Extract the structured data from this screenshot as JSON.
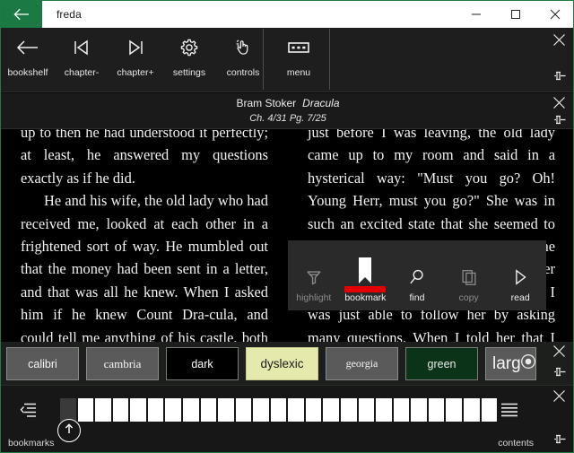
{
  "window": {
    "title": "freda",
    "back_icon": "back-arrow-icon",
    "minimize_label": "─",
    "maximize_label": "☐",
    "close_label": "✕",
    "accent_color": "#1b7a43"
  },
  "toolbar": {
    "items": [
      {
        "label": "bookshelf",
        "icon": "back-arrow-icon"
      },
      {
        "label": "chapter-",
        "icon": "previous-chapter-icon"
      },
      {
        "label": "chapter+",
        "icon": "next-chapter-icon"
      },
      {
        "label": "settings",
        "icon": "gear-icon"
      },
      {
        "label": "controls",
        "icon": "hand-tap-icon"
      },
      {
        "label": "menu",
        "icon": "menu-box-icon"
      }
    ],
    "close_icon": "close-icon",
    "pin_icon": "pin-icon"
  },
  "book_header": {
    "author": "Bram Stoker",
    "title": "Dracula",
    "position": "Ch. 4/31 Pg. 7/25",
    "close_icon": "close-icon",
    "pin_icon": "pin-icon"
  },
  "reader": {
    "left_page": {
      "paragraph_1": "up to then he had understood it perfectly; at least, he answered my questions exactly as if he did.",
      "paragraph_2": "He and his wife, the old lady who had received me, looked at each other in a frightened sort of way. He mumbled out that the money had been sent in a letter, and that was all he knew. When I asked him if he knew Count Dra-cula, and could tell me anything of his castle, both he and his wife"
    },
    "right_page": {
      "paragraph_1": "just before I was leaving, the old lady came up to my room and said in a hysterical way: \"Must you go? Oh! Young Herr, must you go?\" She was in such an excited state that she seemed to have lost her grip of what German she knew, and mixed it all up with some other language which I did not know at all. I was just able to follow her by asking many questions. When I told her that I must go at once, and that I was engaged on important"
    }
  },
  "context_menu": {
    "items": [
      {
        "label": "highlight",
        "icon": "highlighter-icon",
        "state": "dimmed",
        "selected": false
      },
      {
        "label": "bookmark",
        "icon": "bookmark-icon",
        "state": "active",
        "selected": true
      },
      {
        "label": "find",
        "icon": "search-icon",
        "state": "active",
        "selected": false
      },
      {
        "label": "copy",
        "icon": "copy-icon",
        "state": "dimmed",
        "selected": false
      },
      {
        "label": "read",
        "icon": "play-icon",
        "state": "active",
        "selected": false
      }
    ],
    "selection_color": "#e40000"
  },
  "font_bar": {
    "buttons": [
      {
        "label": "calibri",
        "style": "t-calibri"
      },
      {
        "label": "cambria",
        "style": "t-cambria"
      },
      {
        "label": "dark",
        "style": "t-dark"
      },
      {
        "label": "dyslexic",
        "style": "t-dyslexic"
      },
      {
        "label": "georgia",
        "style": "t-georgia"
      },
      {
        "label": "green",
        "style": "t-green"
      },
      {
        "label": "larg",
        "style": "t-large"
      }
    ],
    "radio_icon": "radio-selected-icon",
    "close_icon": "close-icon",
    "pin_icon": "pin-icon"
  },
  "bottom_bar": {
    "bookmarks_label": "bookmarks",
    "bookmarks_icon": "bookmarks-list-icon",
    "contents_label": "contents",
    "contents_icon": "contents-list-icon",
    "close_icon": "close-icon",
    "progress": {
      "total_segments": 25,
      "current_segment": 1,
      "marker_icon": "up-arrow-icon"
    }
  }
}
